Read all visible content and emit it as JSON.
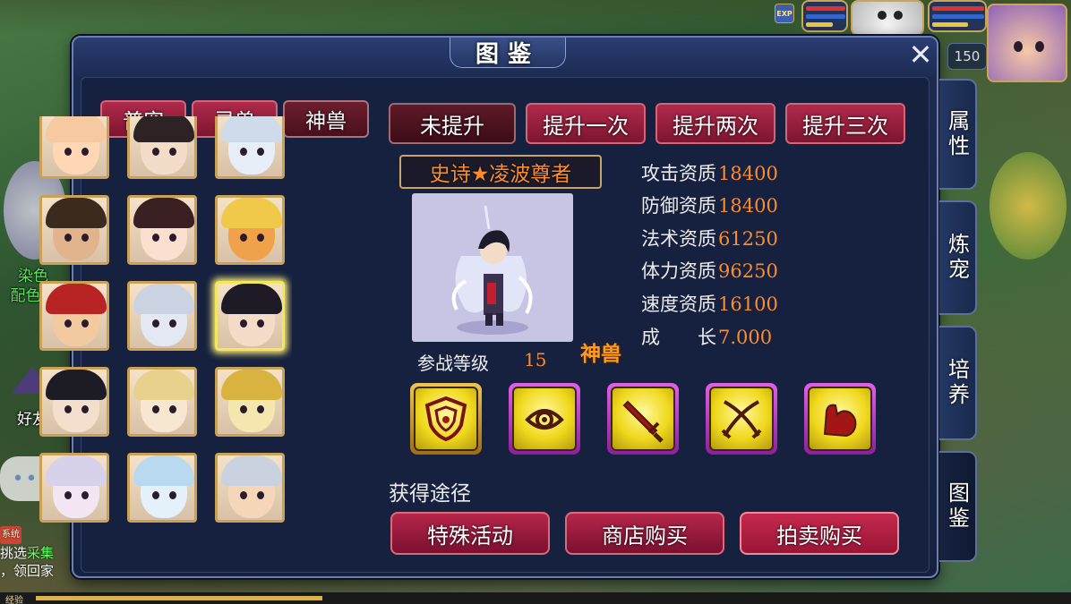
{
  "hud": {
    "level": "150",
    "exp_badge": "EXP",
    "friend_label": "好友",
    "chat_bubble": "•••",
    "npc_label_line1": "染色",
    "npc_label_line2": "配色师",
    "chat_line1": "挑选",
    "chat_line1b": "采集",
    "chat_line2": "，领回家",
    "system_tag": "系统",
    "exp_label": "经验"
  },
  "dialog": {
    "title": "图鉴",
    "close_label": "✕"
  },
  "category_tabs": [
    {
      "label": "普宠",
      "active": false
    },
    {
      "label": "灵兽",
      "active": false
    },
    {
      "label": "神兽",
      "active": true
    }
  ],
  "stage_tabs": [
    {
      "label": "未提升",
      "active": true
    },
    {
      "label": "提升一次",
      "active": false
    },
    {
      "label": "提升两次",
      "active": false
    },
    {
      "label": "提升三次",
      "active": false
    }
  ],
  "pets": [
    {
      "name": "pet-1",
      "skin": "#ffd7b4",
      "hair": "#f7c9a0"
    },
    {
      "name": "pet-2",
      "skin": "#f3dcc8",
      "hair": "#2d2324"
    },
    {
      "name": "pet-3",
      "skin": "#e7eef7",
      "hair": "#cfdaea"
    },
    {
      "name": "pet-4",
      "skin": "#e1b48d",
      "hair": "#3b2a1e"
    },
    {
      "name": "pet-5",
      "skin": "#fbe0cf",
      "hair": "#3a2023"
    },
    {
      "name": "pet-6",
      "skin": "#f0a24a",
      "hair": "#f0c84a"
    },
    {
      "name": "pet-7",
      "skin": "#f3c9a0",
      "hair": "#b82323"
    },
    {
      "name": "pet-8",
      "skin": "#e4e8f2",
      "hair": "#cbd3e3"
    },
    {
      "name": "pet-9",
      "skin": "#f4dcc8",
      "hair": "#1e1a26",
      "selected": true
    },
    {
      "name": "pet-10",
      "skin": "#f4dfcc",
      "hair": "#1d1b24"
    },
    {
      "name": "pet-11",
      "skin": "#f7e6d0",
      "hair": "#e6d28c"
    },
    {
      "name": "pet-12",
      "skin": "#f6e6b0",
      "hair": "#d9b340"
    },
    {
      "name": "pet-13",
      "skin": "#f1e6f2",
      "hair": "#d7d1ea"
    },
    {
      "name": "pet-14",
      "skin": "#e4f0fa",
      "hair": "#b9d9f0"
    },
    {
      "name": "pet-15",
      "skin": "#f5d6b8",
      "hair": "#c9d2de"
    }
  ],
  "detail": {
    "name": "史诗★凌波尊者",
    "level_label": "参战等级",
    "level_value": "15",
    "type_badge": "神兽",
    "stats": [
      {
        "label": "攻击资质",
        "value": "18400"
      },
      {
        "label": "防御资质",
        "value": "18400"
      },
      {
        "label": "法术资质",
        "value": "61250"
      },
      {
        "label": "体力资质",
        "value": "96250"
      },
      {
        "label": "速度资质",
        "value": "16100"
      },
      {
        "label": "成　　长",
        "value": "7.000"
      }
    ]
  },
  "skills": [
    {
      "icon": "shield-icon",
      "frame": "gold"
    },
    {
      "icon": "eye-icon",
      "frame": "purple"
    },
    {
      "icon": "sword-icon",
      "frame": "purple"
    },
    {
      "icon": "crossed-swords-icon",
      "frame": "purple"
    },
    {
      "icon": "muscle-arm-icon",
      "frame": "purple"
    }
  ],
  "obtain": {
    "label": "获得途径",
    "buttons": [
      "特殊活动",
      "商店购买",
      "拍卖购买"
    ]
  },
  "side_tabs": [
    {
      "label": "属性",
      "active": false
    },
    {
      "label": "炼宠",
      "active": false
    },
    {
      "label": "培养",
      "active": false
    },
    {
      "label": "图鉴",
      "active": true
    }
  ],
  "colors": {
    "accent_orange": "#ff8c2a",
    "tab_red": "#b02a4a",
    "panel_navy": "#16213f"
  }
}
